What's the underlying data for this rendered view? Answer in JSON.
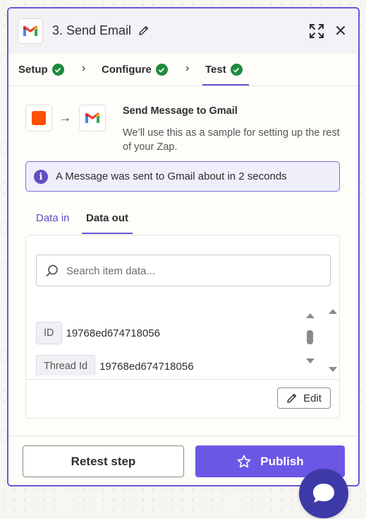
{
  "header": {
    "step_title": "3. Send Email",
    "app_icon": "gmail-icon",
    "actions": [
      "edit-title-icon",
      "expand-icon",
      "close-icon"
    ]
  },
  "steps": [
    {
      "label": "Setup",
      "status": "complete"
    },
    {
      "label": "Configure",
      "status": "complete"
    },
    {
      "label": "Test",
      "status": "complete",
      "active": true
    }
  ],
  "action": {
    "title": "Send Message to Gmail",
    "description": "We’ll use this as a sample for setting up the rest of your Zap."
  },
  "info_banner": {
    "text": "A Message was sent to Gmail about in 2 seconds",
    "icon": "info-icon"
  },
  "data_tabs": [
    {
      "label": "Data in",
      "active": false
    },
    {
      "label": "Data out",
      "active": true
    }
  ],
  "search": {
    "placeholder": "Search item data...",
    "value": ""
  },
  "fields": [
    {
      "key": "ID",
      "value": "19768ed674718056"
    },
    {
      "key": "Thread Id",
      "value": "19768ed674718056"
    }
  ],
  "edit_label": "Edit",
  "footer": {
    "retest_label": "Retest step",
    "publish_label": "Publish"
  },
  "colors": {
    "accent": "#6457d8",
    "publish": "#6b57e6",
    "success": "#1e8a3c",
    "trigger": "#ff4f00",
    "chat": "#3d3aa8"
  }
}
